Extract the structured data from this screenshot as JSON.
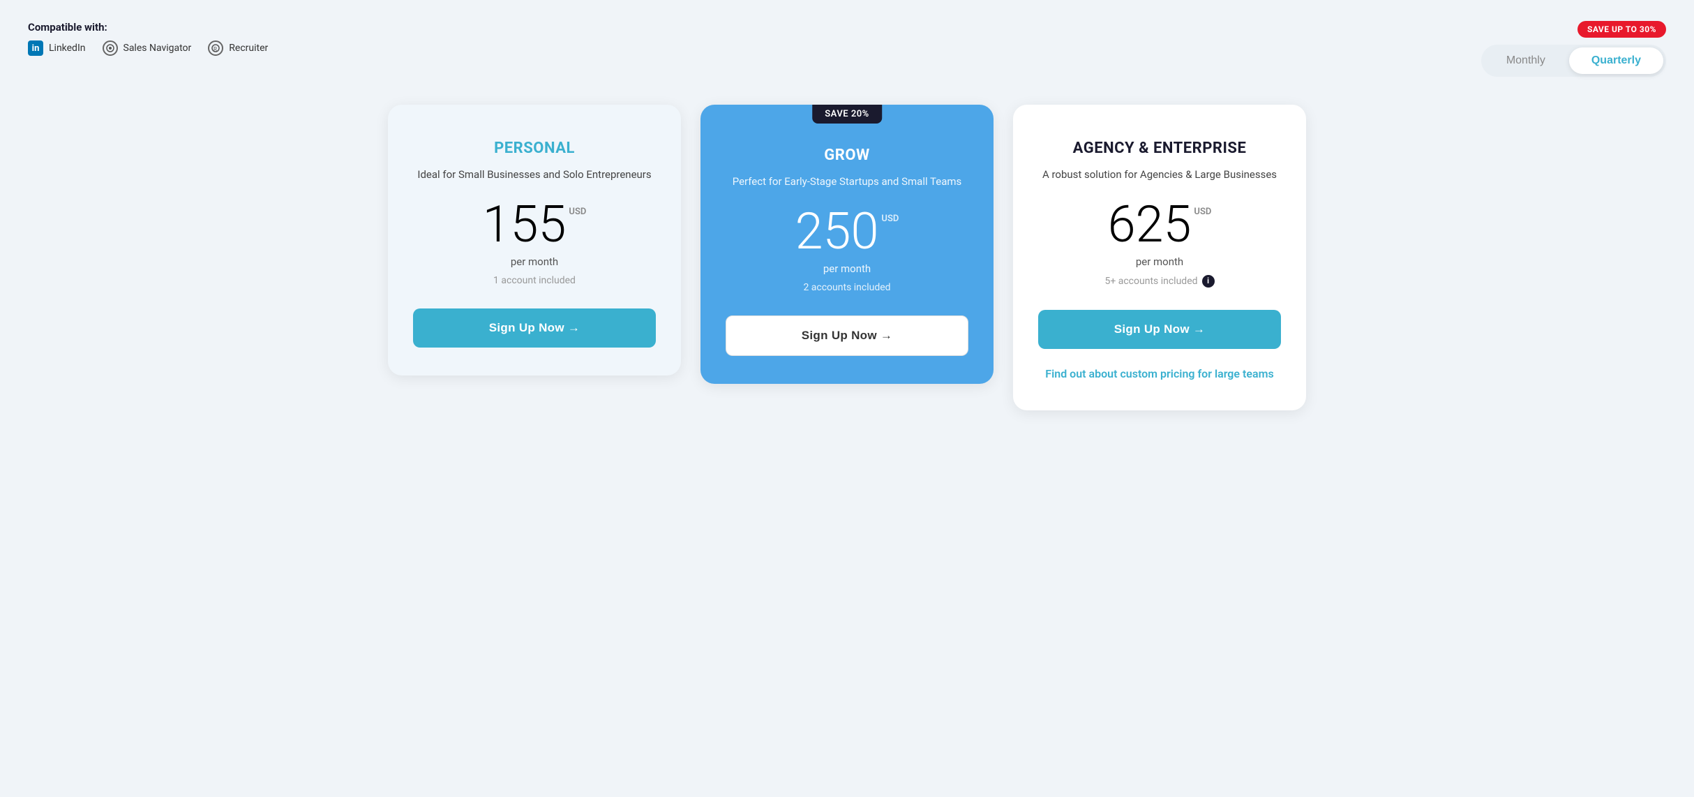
{
  "header": {
    "compatible_label": "Compatible with:",
    "platforms": [
      {
        "name": "LinkedIn",
        "icon": "linkedin-icon"
      },
      {
        "name": "Sales Navigator",
        "icon": "sales-navigator-icon"
      },
      {
        "name": "Recruiter",
        "icon": "recruiter-icon"
      }
    ],
    "save_badge": "SAVE UP TO 30%",
    "toggle": {
      "monthly_label": "Monthly",
      "quarterly_label": "Quarterly",
      "active": "quarterly"
    }
  },
  "plans": [
    {
      "id": "personal",
      "name": "PERSONAL",
      "description": "Ideal for Small Businesses and Solo Entrepreneurs",
      "price": "155",
      "currency": "USD",
      "per_month": "per month",
      "accounts": "1 account included",
      "cta": "Sign Up Now →",
      "style": "light",
      "save_tag": null
    },
    {
      "id": "grow",
      "name": "GROW",
      "description": "Perfect for Early-Stage Startups and Small Teams",
      "price": "250",
      "currency": "USD",
      "per_month": "per month",
      "accounts": "2 accounts included",
      "cta": "Sign Up Now →",
      "style": "blue",
      "save_tag": "SAVE 20%"
    },
    {
      "id": "enterprise",
      "name": "AGENCY & ENTERPRISE",
      "description": "A robust solution for Agencies & Large Businesses",
      "price": "625",
      "currency": "USD",
      "per_month": "per month",
      "accounts": "5+ accounts included",
      "show_info": true,
      "cta": "Sign Up Now →",
      "style": "enterprise",
      "save_tag": null
    }
  ],
  "custom_pricing": {
    "text": "Find out about custom pricing for large teams"
  }
}
